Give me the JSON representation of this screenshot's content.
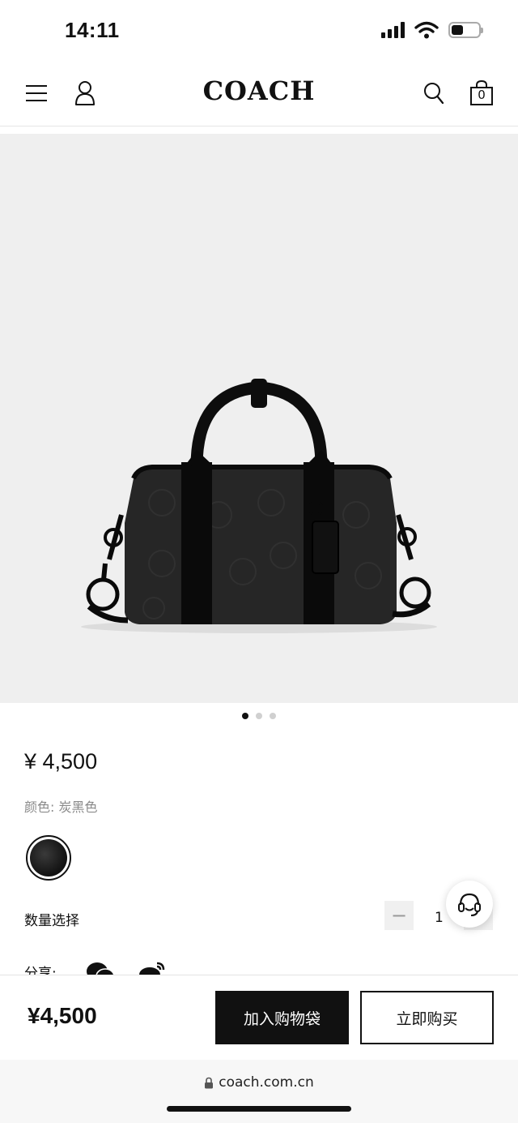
{
  "status": {
    "time": "14:11",
    "signal_icon": "cellular-signal-icon",
    "wifi_icon": "wifi-icon",
    "battery_icon": "battery-icon",
    "battery_level": 0.45
  },
  "header": {
    "menu_icon": "hamburger-menu-icon",
    "account_icon": "user-icon",
    "logo": "COACH",
    "search_icon": "search-icon",
    "bag_icon": "shopping-bag-icon",
    "bag_count": "0"
  },
  "gallery": {
    "image": "black signature canvas barrel bag",
    "page_count": 3,
    "active_index": 0
  },
  "product": {
    "price": "¥ 4,500",
    "color_label": "颜色: 炭黑色",
    "swatch_color": "#1a1a1a"
  },
  "quantity": {
    "label": "数量选择",
    "value": "1",
    "minus": "−",
    "plus": "+"
  },
  "share": {
    "label": "分享:",
    "icons": [
      "wechat-icon",
      "weibo-icon"
    ]
  },
  "chat": {
    "icon": "customer-service-headset-icon"
  },
  "bottom_bar": {
    "price": "¥4,500",
    "add_to_cart": "加入购物袋",
    "buy_now": "立即购买"
  },
  "browser": {
    "lock_icon": "lock-icon",
    "url": "coach.com.cn"
  }
}
